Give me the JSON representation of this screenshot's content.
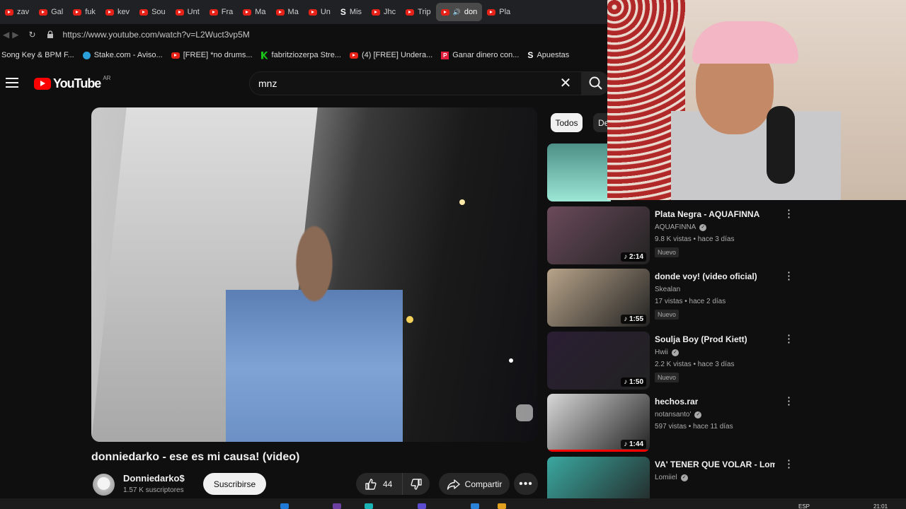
{
  "browser": {
    "tabs": [
      {
        "label": "zav",
        "icon": "youtube-icon"
      },
      {
        "label": "Gal",
        "icon": "youtube-icon"
      },
      {
        "label": "fuk",
        "icon": "youtube-icon"
      },
      {
        "label": "kev",
        "icon": "youtube-icon"
      },
      {
        "label": "Sou",
        "icon": "youtube-icon"
      },
      {
        "label": "Unt",
        "icon": "youtube-icon"
      },
      {
        "label": "Fra",
        "icon": "youtube-icon"
      },
      {
        "label": "Ma",
        "icon": "youtube-icon"
      },
      {
        "label": "Ma",
        "icon": "youtube-icon"
      },
      {
        "label": "Un",
        "icon": "youtube-icon"
      },
      {
        "label": "Mis",
        "icon": "stake-icon"
      },
      {
        "label": "Jhc",
        "icon": "youtube-icon"
      },
      {
        "label": "Trip",
        "icon": "youtube-icon"
      },
      {
        "label": "don",
        "icon": "youtube-icon",
        "active": true
      },
      {
        "label": "Pla",
        "icon": "youtube-icon"
      }
    ],
    "url": "https://www.youtube.com/watch?v=L2Wuct3vp5M",
    "bookmarks": [
      {
        "label": "Song Key & BPM F...",
        "icon": "none"
      },
      {
        "label": "Stake.com - Aviso...",
        "icon": "telegram-icon"
      },
      {
        "label": "[FREE] *no drums...",
        "icon": "youtube-icon"
      },
      {
        "label": "fabritziozerpa Stre...",
        "icon": "kick-icon"
      },
      {
        "label": "(4) [FREE] Undera...",
        "icon": "youtube-icon"
      },
      {
        "label": "Ganar dinero con...",
        "icon": "patreon-icon"
      },
      {
        "label": "Apuestas",
        "icon": "stake-icon"
      }
    ]
  },
  "youtube": {
    "logo_text": "YouTube",
    "country": "AR",
    "search_value": "mnz",
    "video_title": "donniedarko - ese es mi causa! (video)",
    "channel_name": "Donniedarko$",
    "subscribers": "1.57 K suscriptores",
    "subscribe_label": "Suscribirse",
    "likes": "44",
    "share_label": "Compartir",
    "chips": [
      "Todos",
      "De"
    ],
    "related": [
      {
        "title": "Plata Negra - AQUAFINNA",
        "channel": "AQUAFINNA",
        "verified": true,
        "meta": "9.8 K vistas • hace 3 días",
        "badge": "Nuevo",
        "duration": "2:14",
        "thumb": "#6a4a5a"
      },
      {
        "title": "donde voy! (video oficial)",
        "channel": "Skealan",
        "verified": false,
        "meta": "17 vistas • hace 2 días",
        "badge": "Nuevo",
        "duration": "1:55",
        "thumb": "#b8a48a"
      },
      {
        "title": "Soulja Boy (Prod Kiett)",
        "channel": "Hwii",
        "verified": true,
        "meta": "2.2 K vistas • hace 3 días",
        "badge": "Nuevo",
        "duration": "1:50",
        "thumb": "#2a1e33"
      },
      {
        "title": "hechos.rar",
        "channel": "notansanto'",
        "verified": true,
        "meta": "597 vistas • hace 11 días",
        "badge": "",
        "duration": "1:44",
        "thumb": "#d8d8d8"
      },
      {
        "title": "VA' TENER QUE VOLAR - Lomiiel, Beear Music, Cm ...",
        "channel": "Lomiiel",
        "verified": true,
        "meta": "",
        "badge": "",
        "duration": "",
        "thumb": "#3aa8a0"
      }
    ]
  },
  "system": {
    "language": "ESP",
    "time": "21:01"
  },
  "colors": {
    "accent": "#ff0000",
    "background": "#0f0f0f",
    "chip_active": "#f1f1f1"
  }
}
